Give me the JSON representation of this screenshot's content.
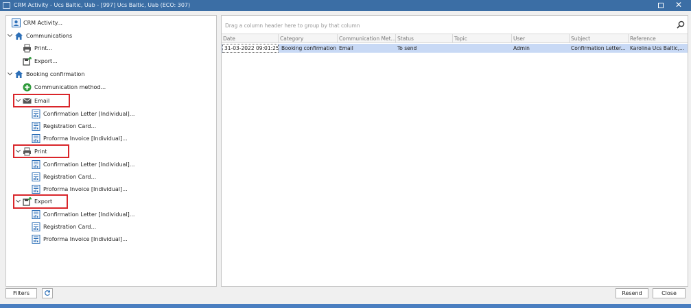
{
  "window": {
    "title": "CRM Activity - Ucs Baltic, Uab  - [997] Ucs Baltic, Uab (ECO: 307)",
    "maximize_icon": "maximize-icon",
    "close_glyph": "✕"
  },
  "tree": {
    "crm_activity": "CRM Activity...",
    "communications": "Communications",
    "print": "Print...",
    "export": "Export...",
    "booking_confirmation": "Booking confirmation",
    "communication_method": "Communication method...",
    "email": "Email",
    "email_items": [
      "Confirmation Letter [Individual]...",
      "Registration Card...",
      "Proforma Invoice [Individual]..."
    ],
    "print_group": "Print",
    "print_items": [
      "Confirmation Letter [Individual]...",
      "Registration Card...",
      "Proforma Invoice [Individual]..."
    ],
    "export_group": "Export",
    "export_items": [
      "Confirmation Letter [Individual]...",
      "Registration Card...",
      "Proforma Invoice [Individual]..."
    ]
  },
  "grid": {
    "group_hint": "Drag a column header here to group by that column",
    "columns": [
      "Date",
      "Category",
      "Communication Met...",
      "Status",
      "Topic",
      "User",
      "Subject",
      "Reference"
    ],
    "rows": [
      [
        "31-03-2022 09:01:25",
        "Booking confirmation",
        "Email",
        "To send",
        "",
        "Admin",
        "Confirmation Letter...",
        "Karolina Ucs Baltic,..."
      ]
    ]
  },
  "buttons": {
    "filters": "Filters",
    "resend": "Resend",
    "close": "Close"
  },
  "colors": {
    "title_bar": "#3b6ea5",
    "selected_row": "#c8d9f5",
    "highlight_box": "#d9252a"
  }
}
